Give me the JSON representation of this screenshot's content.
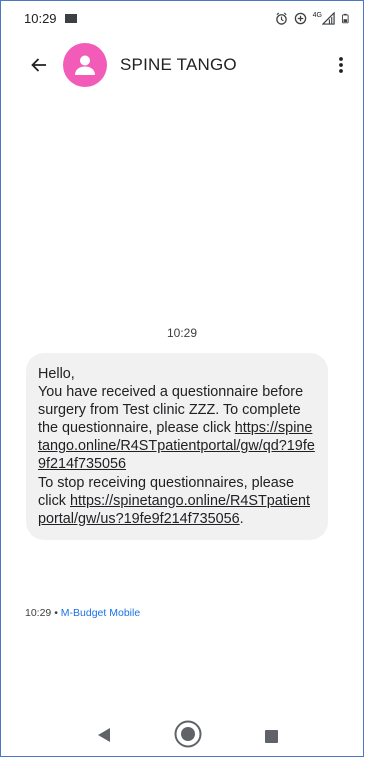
{
  "status_bar": {
    "time": "10:29",
    "network_label": "4G"
  },
  "header": {
    "contact_name": "SPINE TANGO"
  },
  "conversation": {
    "timestamp": "10:29",
    "message": {
      "line_hello": "Hello,",
      "line_1": "You have received a questionnaire before surgery from Test clinic ZZZ. To complete the questionnaire, please click ",
      "link_1": "https://spinetango.online/R4STpatientportal/gw/qd?19fe9f214f735056",
      "line_2": "To stop receiving questionnaires, please click ",
      "link_2": "https://spinetango.online/R4STpatientportal/gw/us?19fe9f214f735056",
      "line_end": "."
    },
    "meta_time": "10:29",
    "meta_separator": " • ",
    "meta_carrier": "M-Budget Mobile"
  },
  "colors": {
    "avatar": "#f35bb8",
    "bubble": "#f1f1f1",
    "carrier": "#1a73e8"
  }
}
